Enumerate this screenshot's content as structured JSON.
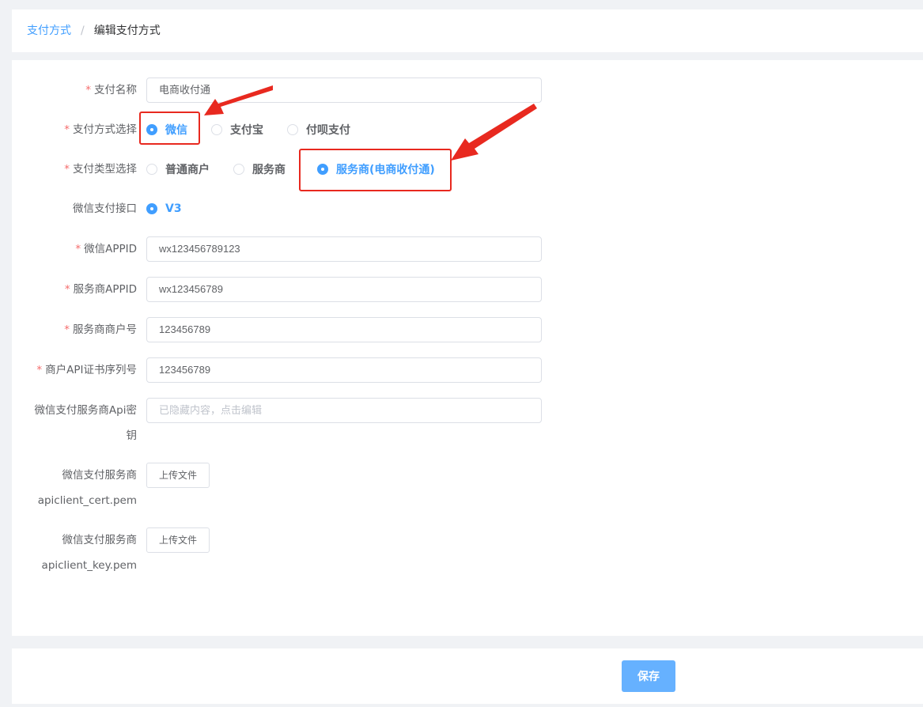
{
  "breadcrumb": {
    "parent": "支付方式",
    "separator": "/",
    "current": "编辑支付方式"
  },
  "form": {
    "name": {
      "label": "支付名称",
      "required": true,
      "value": "电商收付通"
    },
    "payment_method": {
      "label": "支付方式选择",
      "required": true,
      "options": [
        "微信",
        "支付宝",
        "付呗支付"
      ],
      "selected": "微信"
    },
    "payment_type": {
      "label": "支付类型选择",
      "required": true,
      "options": [
        "普通商户",
        "服务商",
        "服务商(电商收付通)"
      ],
      "selected": "服务商(电商收付通)"
    },
    "wechat_api": {
      "label": "微信支付接口",
      "required": false,
      "options": [
        "V3"
      ],
      "selected": "V3"
    },
    "wechat_appid": {
      "label": "微信APPID",
      "required": true,
      "value": "wx123456789123"
    },
    "provider_appid": {
      "label": "服务商APPID",
      "required": true,
      "value": "wx123456789"
    },
    "provider_mchid": {
      "label": "服务商商户号",
      "required": true,
      "value": "123456789"
    },
    "cert_serial": {
      "label": "商户API证书序列号",
      "required": true,
      "value": "123456789"
    },
    "api_key": {
      "label_line1": "微信支付服务商Api密",
      "label_line2": "钥",
      "required": false,
      "value": "",
      "placeholder": "已隐藏内容，点击编辑"
    },
    "cert_file": {
      "label_line1": "微信支付服务商",
      "label_line2": "apiclient_cert.pem",
      "button": "上传文件"
    },
    "key_file": {
      "label_line1": "微信支付服务商",
      "label_line2": "apiclient_key.pem",
      "button": "上传文件"
    }
  },
  "footer": {
    "save_label": "保存"
  },
  "colors": {
    "primary": "#409eff",
    "required_star": "#f56c6c",
    "annotation": "#e8291f",
    "save_button": "#66b1ff"
  }
}
